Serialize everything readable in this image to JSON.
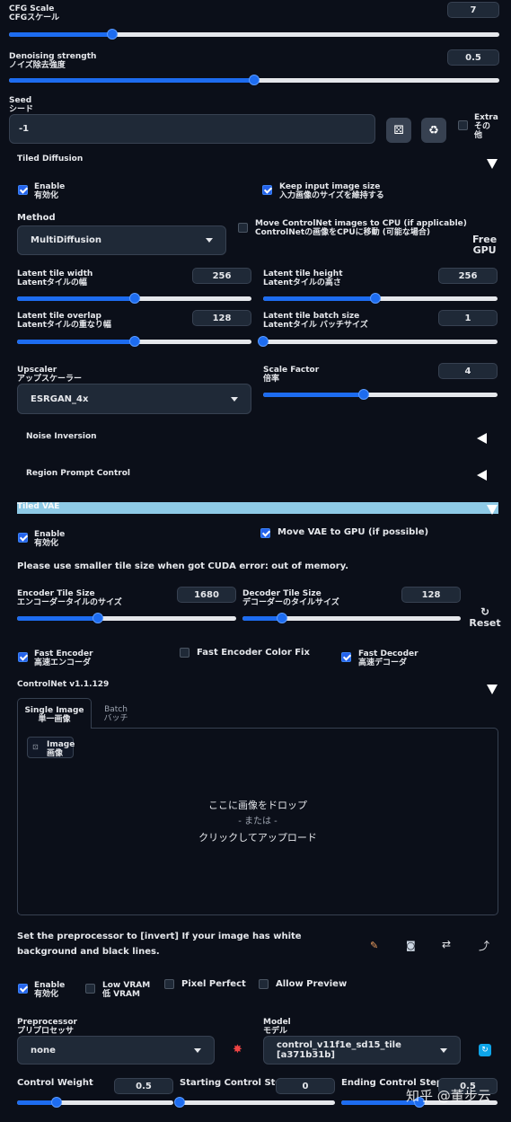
{
  "cfg": {
    "label1": "CFG Scale",
    "label2": "CFGスケール",
    "value": "7",
    "pos": 0.21
  },
  "denoise": {
    "label1": "Denoising strength",
    "label2": "ノイズ除去強度",
    "value": "0.5",
    "pos": 0.5
  },
  "seed": {
    "label1": "Seed",
    "label2": "シード",
    "value": "-1",
    "dice_icon": "dice-icon",
    "recycle_icon": "recycle-icon",
    "extra_label": "Extra\nその\n他"
  },
  "tiled_diffusion": {
    "title": "Tiled Diffusion",
    "enable1": "Enable",
    "enable2": "有効化",
    "keep1": "Keep input image size",
    "keep2": "入力画像のサイズを維持する",
    "method_label": "Method",
    "method_value": "MultiDiffusion",
    "move1": "Move ControlNet images to CPU (if applicable)",
    "move2": "ControlNetの画像をCPUに移動 (可能な場合)",
    "free_gpu": "Free\nGPU",
    "tile_w": {
      "label1": "Latent tile width",
      "label2": "Latentタイルの幅",
      "value": "256",
      "pos": 0.5
    },
    "tile_h": {
      "label1": "Latent tile height",
      "label2": "Latentタイルの高さ",
      "value": "256",
      "pos": 0.48
    },
    "overlap": {
      "label1": "Latent tile overlap",
      "label2": "Latentタイルの重なり幅",
      "value": "128",
      "pos": 0.5
    },
    "batch": {
      "label1": "Latent tile batch size",
      "label2": "Latentタイル バッチサイズ",
      "value": "1",
      "pos": 0.0
    },
    "upscaler_label1": "Upscaler",
    "upscaler_label2": "アップスケーラー",
    "upscaler_value": "ESRGAN_4x",
    "scale": {
      "label1": "Scale Factor",
      "label2": "倍率",
      "value": "4",
      "pos": 0.43
    },
    "noise_inversion": "Noise Inversion",
    "region_prompt": "Region Prompt Control"
  },
  "tiled_vae": {
    "title": "Tiled VAE",
    "enable1": "Enable",
    "enable2": "有効化",
    "move_vae": "Move VAE to GPU (if possible)",
    "note": "Please use smaller tile size when got CUDA error: out of memory.",
    "enc": {
      "label1": "Encoder Tile Size",
      "label2": "エンコーダータイルのサイズ",
      "value": "1680",
      "pos": 0.37
    },
    "dec": {
      "label1": "Decoder Tile Size",
      "label2": "デコーダーのタイルサイズ",
      "value": "128",
      "pos": 0.18
    },
    "reset": "Reset",
    "fast_enc1": "Fast Encoder",
    "fast_enc2": "高速エンコーダ",
    "color_fix": "Fast Encoder Color Fix",
    "fast_dec1": "Fast Decoder",
    "fast_dec2": "高速デコーダ"
  },
  "controlnet": {
    "title": "ControlNet v1.1.129",
    "tab1a": "Single Image",
    "tab1b": "単一画像",
    "tab2a": "Batch",
    "tab2b": "バッチ",
    "image_label1": "Image",
    "image_label2": "画像",
    "drop1": "ここに画像をドロップ",
    "drop2": "- または -",
    "drop3": "クリックしてアップロード",
    "invert_note": "Set the preprocessor to [invert] If your image has white background and black lines.",
    "enable1": "Enable",
    "enable2": "有効化",
    "lowvram1": "Low VRAM",
    "lowvram2": "低 VRAM",
    "pixel_perfect": "Pixel Perfect",
    "allow_preview": "Allow Preview",
    "pre_label1": "Preprocessor",
    "pre_label2": "プリプロセッサ",
    "pre_value": "none",
    "model_label1": "Model",
    "model_label2": "モデル",
    "model_value": "control_v11f1e_sd15_tile [a371b31b]",
    "weight": {
      "label": "Control Weight",
      "value": "0.5",
      "pos": 0.25
    },
    "start": {
      "label": "Starting Control Step",
      "value": "0",
      "pos": 0.0
    },
    "end": {
      "label": "Ending Control Step",
      "value": "0.5",
      "pos": 0.5
    }
  },
  "watermark": "知乎 @董步云"
}
